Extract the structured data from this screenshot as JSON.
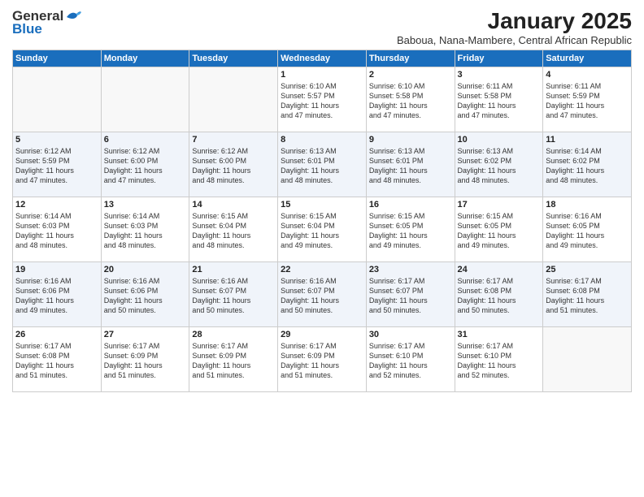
{
  "header": {
    "logo_general": "General",
    "logo_blue": "Blue",
    "month_year": "January 2025",
    "location": "Baboua, Nana-Mambere, Central African Republic"
  },
  "weekdays": [
    "Sunday",
    "Monday",
    "Tuesday",
    "Wednesday",
    "Thursday",
    "Friday",
    "Saturday"
  ],
  "weeks": [
    [
      {
        "day": "",
        "info": ""
      },
      {
        "day": "",
        "info": ""
      },
      {
        "day": "",
        "info": ""
      },
      {
        "day": "1",
        "info": "Sunrise: 6:10 AM\nSunset: 5:57 PM\nDaylight: 11 hours\nand 47 minutes."
      },
      {
        "day": "2",
        "info": "Sunrise: 6:10 AM\nSunset: 5:58 PM\nDaylight: 11 hours\nand 47 minutes."
      },
      {
        "day": "3",
        "info": "Sunrise: 6:11 AM\nSunset: 5:58 PM\nDaylight: 11 hours\nand 47 minutes."
      },
      {
        "day": "4",
        "info": "Sunrise: 6:11 AM\nSunset: 5:59 PM\nDaylight: 11 hours\nand 47 minutes."
      }
    ],
    [
      {
        "day": "5",
        "info": "Sunrise: 6:12 AM\nSunset: 5:59 PM\nDaylight: 11 hours\nand 47 minutes."
      },
      {
        "day": "6",
        "info": "Sunrise: 6:12 AM\nSunset: 6:00 PM\nDaylight: 11 hours\nand 47 minutes."
      },
      {
        "day": "7",
        "info": "Sunrise: 6:12 AM\nSunset: 6:00 PM\nDaylight: 11 hours\nand 48 minutes."
      },
      {
        "day": "8",
        "info": "Sunrise: 6:13 AM\nSunset: 6:01 PM\nDaylight: 11 hours\nand 48 minutes."
      },
      {
        "day": "9",
        "info": "Sunrise: 6:13 AM\nSunset: 6:01 PM\nDaylight: 11 hours\nand 48 minutes."
      },
      {
        "day": "10",
        "info": "Sunrise: 6:13 AM\nSunset: 6:02 PM\nDaylight: 11 hours\nand 48 minutes."
      },
      {
        "day": "11",
        "info": "Sunrise: 6:14 AM\nSunset: 6:02 PM\nDaylight: 11 hours\nand 48 minutes."
      }
    ],
    [
      {
        "day": "12",
        "info": "Sunrise: 6:14 AM\nSunset: 6:03 PM\nDaylight: 11 hours\nand 48 minutes."
      },
      {
        "day": "13",
        "info": "Sunrise: 6:14 AM\nSunset: 6:03 PM\nDaylight: 11 hours\nand 48 minutes."
      },
      {
        "day": "14",
        "info": "Sunrise: 6:15 AM\nSunset: 6:04 PM\nDaylight: 11 hours\nand 48 minutes."
      },
      {
        "day": "15",
        "info": "Sunrise: 6:15 AM\nSunset: 6:04 PM\nDaylight: 11 hours\nand 49 minutes."
      },
      {
        "day": "16",
        "info": "Sunrise: 6:15 AM\nSunset: 6:05 PM\nDaylight: 11 hours\nand 49 minutes."
      },
      {
        "day": "17",
        "info": "Sunrise: 6:15 AM\nSunset: 6:05 PM\nDaylight: 11 hours\nand 49 minutes."
      },
      {
        "day": "18",
        "info": "Sunrise: 6:16 AM\nSunset: 6:05 PM\nDaylight: 11 hours\nand 49 minutes."
      }
    ],
    [
      {
        "day": "19",
        "info": "Sunrise: 6:16 AM\nSunset: 6:06 PM\nDaylight: 11 hours\nand 49 minutes."
      },
      {
        "day": "20",
        "info": "Sunrise: 6:16 AM\nSunset: 6:06 PM\nDaylight: 11 hours\nand 50 minutes."
      },
      {
        "day": "21",
        "info": "Sunrise: 6:16 AM\nSunset: 6:07 PM\nDaylight: 11 hours\nand 50 minutes."
      },
      {
        "day": "22",
        "info": "Sunrise: 6:16 AM\nSunset: 6:07 PM\nDaylight: 11 hours\nand 50 minutes."
      },
      {
        "day": "23",
        "info": "Sunrise: 6:17 AM\nSunset: 6:07 PM\nDaylight: 11 hours\nand 50 minutes."
      },
      {
        "day": "24",
        "info": "Sunrise: 6:17 AM\nSunset: 6:08 PM\nDaylight: 11 hours\nand 50 minutes."
      },
      {
        "day": "25",
        "info": "Sunrise: 6:17 AM\nSunset: 6:08 PM\nDaylight: 11 hours\nand 51 minutes."
      }
    ],
    [
      {
        "day": "26",
        "info": "Sunrise: 6:17 AM\nSunset: 6:08 PM\nDaylight: 11 hours\nand 51 minutes."
      },
      {
        "day": "27",
        "info": "Sunrise: 6:17 AM\nSunset: 6:09 PM\nDaylight: 11 hours\nand 51 minutes."
      },
      {
        "day": "28",
        "info": "Sunrise: 6:17 AM\nSunset: 6:09 PM\nDaylight: 11 hours\nand 51 minutes."
      },
      {
        "day": "29",
        "info": "Sunrise: 6:17 AM\nSunset: 6:09 PM\nDaylight: 11 hours\nand 51 minutes."
      },
      {
        "day": "30",
        "info": "Sunrise: 6:17 AM\nSunset: 6:10 PM\nDaylight: 11 hours\nand 52 minutes."
      },
      {
        "day": "31",
        "info": "Sunrise: 6:17 AM\nSunset: 6:10 PM\nDaylight: 11 hours\nand 52 minutes."
      },
      {
        "day": "",
        "info": ""
      }
    ]
  ]
}
